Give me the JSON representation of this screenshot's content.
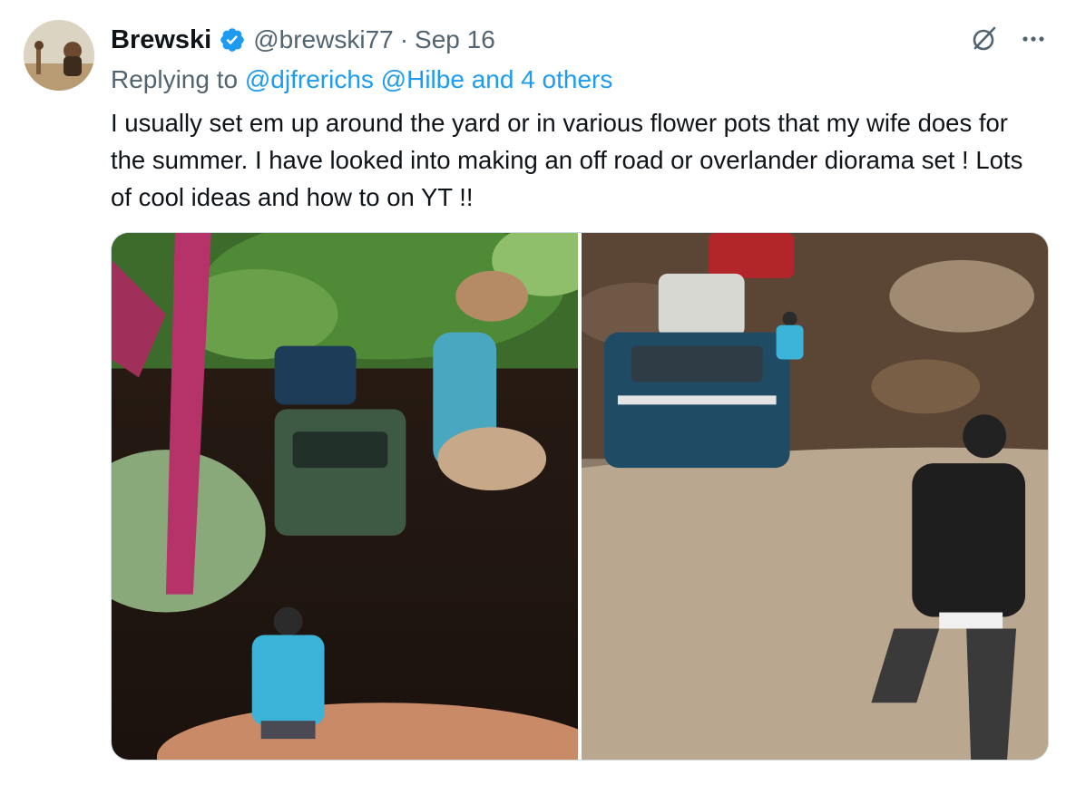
{
  "tweet": {
    "author": {
      "display_name": "Brewski",
      "handle": "@brewski77",
      "verified": true,
      "avatar_icon": "avatar"
    },
    "separator": "·",
    "date": "Sep 16",
    "replying_to": {
      "prefix": "Replying to",
      "mentions": [
        "@djfrerichs",
        "@Hilbe",
        "and 4 others"
      ]
    },
    "text": "I usually set em up around the yard or in various flower pots that my wife does for the summer. I have looked into making an off road or overlander diorama set ! Lots of cool ideas and how to on YT !!",
    "media": [
      {
        "icon": "photo"
      },
      {
        "icon": "photo"
      }
    ]
  },
  "actions": {
    "grok_icon": "grok-icon",
    "more_icon": "more-icon"
  },
  "colors": {
    "accent": "#1d9bf0",
    "text": "#0f1419",
    "secondary": "#536471",
    "border": "#cfd9de"
  }
}
